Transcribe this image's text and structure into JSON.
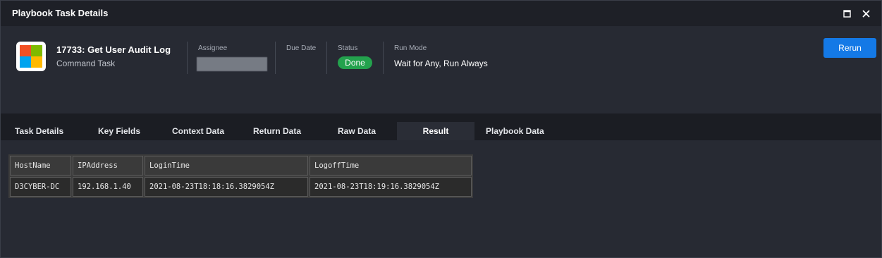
{
  "window": {
    "title": "Playbook Task Details",
    "icons": {
      "maximize": "maximize-icon",
      "close": "close-icon"
    }
  },
  "task": {
    "title": "17733: Get User Audit Log",
    "type": "Command Task",
    "logo_icon": "microsoft-logo-icon"
  },
  "fields": {
    "assignee_label": "Assignee",
    "due_date_label": "Due Date",
    "status_label": "Status",
    "status_value": "Done",
    "run_mode_label": "Run Mode",
    "run_mode_value": "Wait for Any, Run Always"
  },
  "actions": {
    "rerun_label": "Rerun"
  },
  "tabs": [
    {
      "label": "Task Details"
    },
    {
      "label": "Key Fields"
    },
    {
      "label": "Context Data"
    },
    {
      "label": "Return Data"
    },
    {
      "label": "Raw Data"
    },
    {
      "label": "Result",
      "active": true
    },
    {
      "label": "Playbook Data"
    }
  ],
  "result": {
    "columns": [
      "HostName",
      "IPAddress",
      "LoginTime",
      "LogoffTime"
    ],
    "rows": [
      [
        "D3CYBER-DC",
        "192.168.1.40",
        "2021-08-23T18:18:16.3829054Z",
        "2021-08-23T18:19:16.3829054Z"
      ]
    ]
  },
  "colors": {
    "accent": "#1479e6",
    "status_done": "#23a24d",
    "background": "#272a33",
    "titlebar": "#1e2027"
  }
}
